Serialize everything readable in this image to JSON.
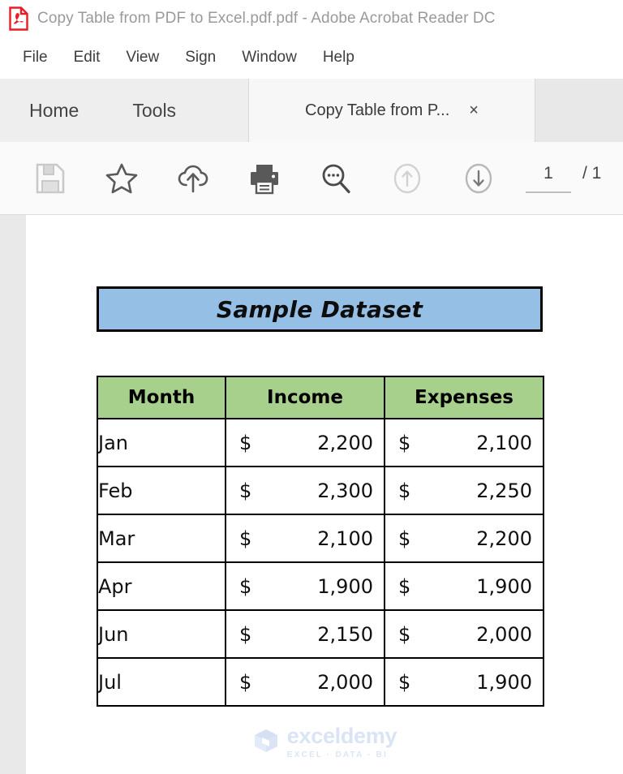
{
  "window": {
    "app_icon": "pdf-document-icon",
    "title": "Copy Table from PDF to Excel.pdf.pdf - Adobe Acrobat Reader DC"
  },
  "menubar": {
    "items": [
      {
        "label": "File"
      },
      {
        "label": "Edit"
      },
      {
        "label": "View"
      },
      {
        "label": "Sign"
      },
      {
        "label": "Window"
      },
      {
        "label": "Help"
      }
    ]
  },
  "tabstrip": {
    "home_label": "Home",
    "tools_label": "Tools",
    "document_tab_label": "Copy Table from P...",
    "close_label": "×"
  },
  "toolbar": {
    "buttons": [
      {
        "name": "save-file-icon",
        "title": "Save File",
        "disabled": true
      },
      {
        "name": "star-bookmark-icon",
        "title": "Add to Favorites",
        "disabled": false
      },
      {
        "name": "cloud-upload-icon",
        "title": "Upload to Cloud",
        "disabled": false
      },
      {
        "name": "print-icon",
        "title": "Print File",
        "disabled": false
      },
      {
        "name": "search-icon",
        "title": "Find Text",
        "disabled": false
      },
      {
        "name": "previous-page-icon",
        "title": "Previous Page",
        "disabled": true
      },
      {
        "name": "next-page-icon",
        "title": "Next Page",
        "disabled": false
      }
    ],
    "page_current": "1",
    "page_total": "/ 1"
  },
  "document": {
    "dataset_title": "Sample Dataset",
    "table": {
      "headers": [
        "Month",
        "Income",
        "Expenses"
      ],
      "currency_symbol": "$",
      "rows": [
        {
          "month": "Jan",
          "income": "2,200",
          "expenses": "2,100"
        },
        {
          "month": "Feb",
          "income": "2,300",
          "expenses": "2,250"
        },
        {
          "month": "Mar",
          "income": "2,100",
          "expenses": "2,200"
        },
        {
          "month": "Apr",
          "income": "1,900",
          "expenses": "1,900"
        },
        {
          "month": "Jun",
          "income": "2,150",
          "expenses": "2,000"
        },
        {
          "month": "Jul",
          "income": "2,000",
          "expenses": "1,900"
        }
      ]
    },
    "watermark": {
      "name": "exceldemy",
      "tagline": "EXCEL · DATA · BI"
    }
  },
  "colors": {
    "title_fill": "#96BFE6",
    "header_fill": "#A8D08D",
    "acrobat_red": "#EC1C24",
    "watermark_blue": "#DBE4F5"
  }
}
